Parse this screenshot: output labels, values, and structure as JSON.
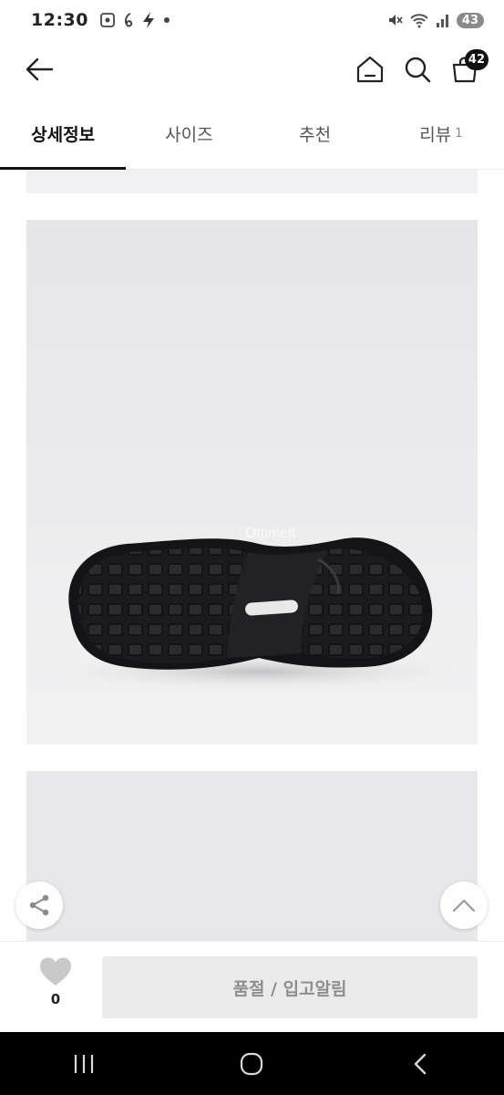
{
  "status_bar": {
    "time": "12:30",
    "left_icons": [
      "screenshot-icon",
      "sync-icon",
      "bolt-icon",
      "dot-icon"
    ],
    "right_icons": [
      "mute-icon",
      "wifi-icon",
      "signal-icon"
    ],
    "battery": "43"
  },
  "header": {
    "cart_badge": "42"
  },
  "tabs": [
    {
      "label": "상세정보",
      "active": true
    },
    {
      "label": "사이즈"
    },
    {
      "label": "추천"
    },
    {
      "label": "리뷰",
      "count": "1"
    }
  ],
  "product_image": {
    "watermark": "Ottimelt"
  },
  "action_bar": {
    "like_count": "0",
    "primary_label": "품절 / 입고알림"
  },
  "colors": {
    "active_tab": "#111111",
    "disabled_button_bg": "#ebebeb",
    "disabled_button_text": "#8e8e8e",
    "nav_bar_bg": "#000000"
  }
}
